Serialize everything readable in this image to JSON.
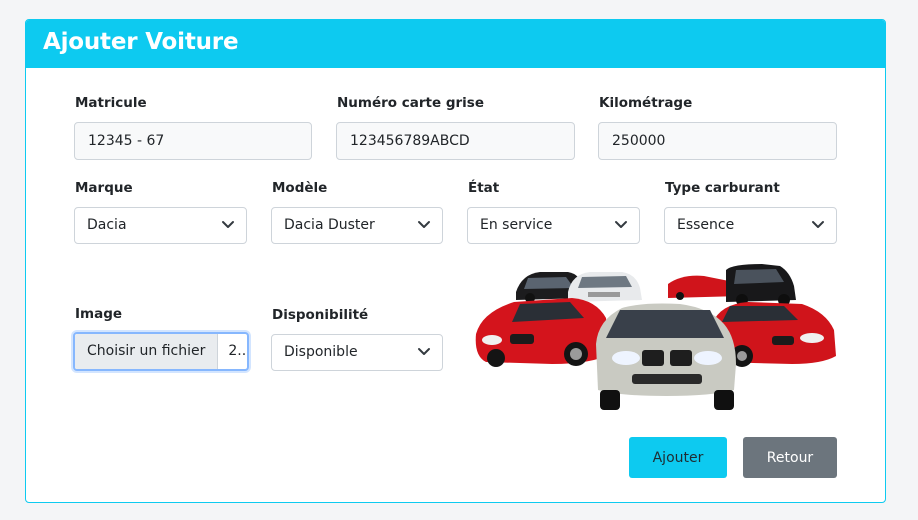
{
  "header": {
    "title": "Ajouter Voiture"
  },
  "form": {
    "matricule": {
      "label": "Matricule",
      "value": "12345 - 67"
    },
    "carte_grise": {
      "label": "Numéro carte grise",
      "value": "123456789ABCD"
    },
    "kilometrage": {
      "label": "Kilométrage",
      "value": "250000"
    },
    "marque": {
      "label": "Marque",
      "selected": "Dacia"
    },
    "modele": {
      "label": "Modèle",
      "selected": "Dacia Duster"
    },
    "etat": {
      "label": "État",
      "selected": "En service"
    },
    "carburant": {
      "label": "Type carburant",
      "selected": "Essence"
    },
    "image": {
      "label": "Image",
      "button_label": "Choisir un fichier",
      "file_name": "2..."
    },
    "disponibilite": {
      "label": "Disponibilité",
      "selected": "Disponible"
    }
  },
  "actions": {
    "add_label": "Ajouter",
    "back_label": "Retour"
  },
  "colors": {
    "accent": "#0dcaf0",
    "secondary": "#6c757d",
    "focus_border": "#86b7fe"
  },
  "icons": {
    "select_arrow": "chevron-down-icon",
    "illustration": "cars-illustration"
  }
}
